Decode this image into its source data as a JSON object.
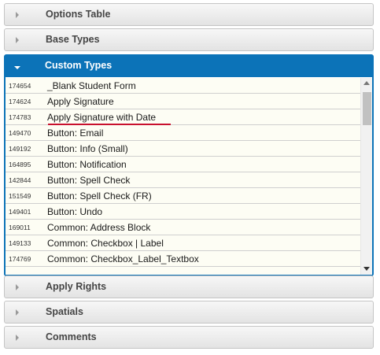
{
  "panels": {
    "options_table": "Options Table",
    "base_types": "Base Types",
    "custom_types": "Custom Types",
    "apply_rights": "Apply Rights",
    "spatials": "Spatials",
    "comments": "Comments"
  },
  "custom_types_list": [
    {
      "id": "174654",
      "name": "_Blank Student Form"
    },
    {
      "id": "174624",
      "name": "Apply Signature"
    },
    {
      "id": "174783",
      "name": "Apply Signature with Date"
    },
    {
      "id": "149470",
      "name": "Button: Email"
    },
    {
      "id": "149192",
      "name": "Button: Info (Small)"
    },
    {
      "id": "164895",
      "name": "Button: Notification"
    },
    {
      "id": "142844",
      "name": "Button: Spell Check"
    },
    {
      "id": "151549",
      "name": "Button: Spell Check (FR)"
    },
    {
      "id": "149401",
      "name": "Button: Undo"
    },
    {
      "id": "169011",
      "name": "Common: Address Block"
    },
    {
      "id": "149133",
      "name": "Common: Checkbox | Label"
    },
    {
      "id": "174769",
      "name": "Common: Checkbox_Label_Textbox"
    }
  ],
  "colors": {
    "accent": "#0c73b8",
    "highlight_underline": "#c8102e",
    "row_background": "#fdfdf4"
  }
}
